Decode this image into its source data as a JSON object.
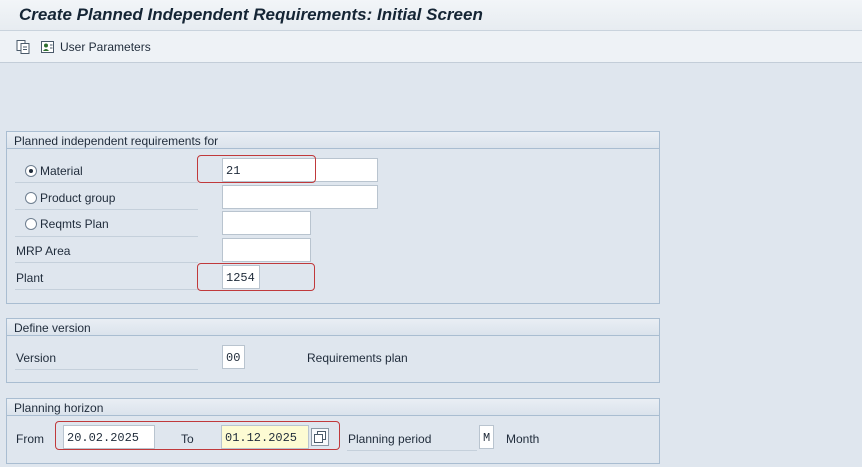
{
  "window": {
    "title": "Create Planned Independent Requirements: Initial Screen"
  },
  "toolbar": {
    "copy_icon": "copy-icon",
    "user_params_icon": "user-parameters-icon",
    "user_params_label": "User Parameters"
  },
  "group1": {
    "title": "Planned independent requirements for",
    "material": {
      "label": "Material",
      "value": "21",
      "selected": true
    },
    "product_group": {
      "label": "Product group",
      "value": ""
    },
    "reqmts_plan": {
      "label": "Reqmts Plan",
      "value": ""
    },
    "mrp_area": {
      "label": "MRP Area",
      "value": ""
    },
    "plant": {
      "label": "Plant",
      "value": "1254"
    }
  },
  "group2": {
    "title": "Define version",
    "version": {
      "label": "Version",
      "value": "00",
      "description": "Requirements plan"
    }
  },
  "group3": {
    "title": "Planning horizon",
    "from": {
      "label": "From",
      "value": "20.02.2025"
    },
    "to": {
      "label": "To",
      "value": "01.12.2025"
    },
    "planning_period": {
      "label": "Planning period",
      "value": "M",
      "description": "Month"
    }
  },
  "colors": {
    "highlight": "#c0393b",
    "background": "#dfe6ee",
    "required_field": "#fdfbd3"
  }
}
